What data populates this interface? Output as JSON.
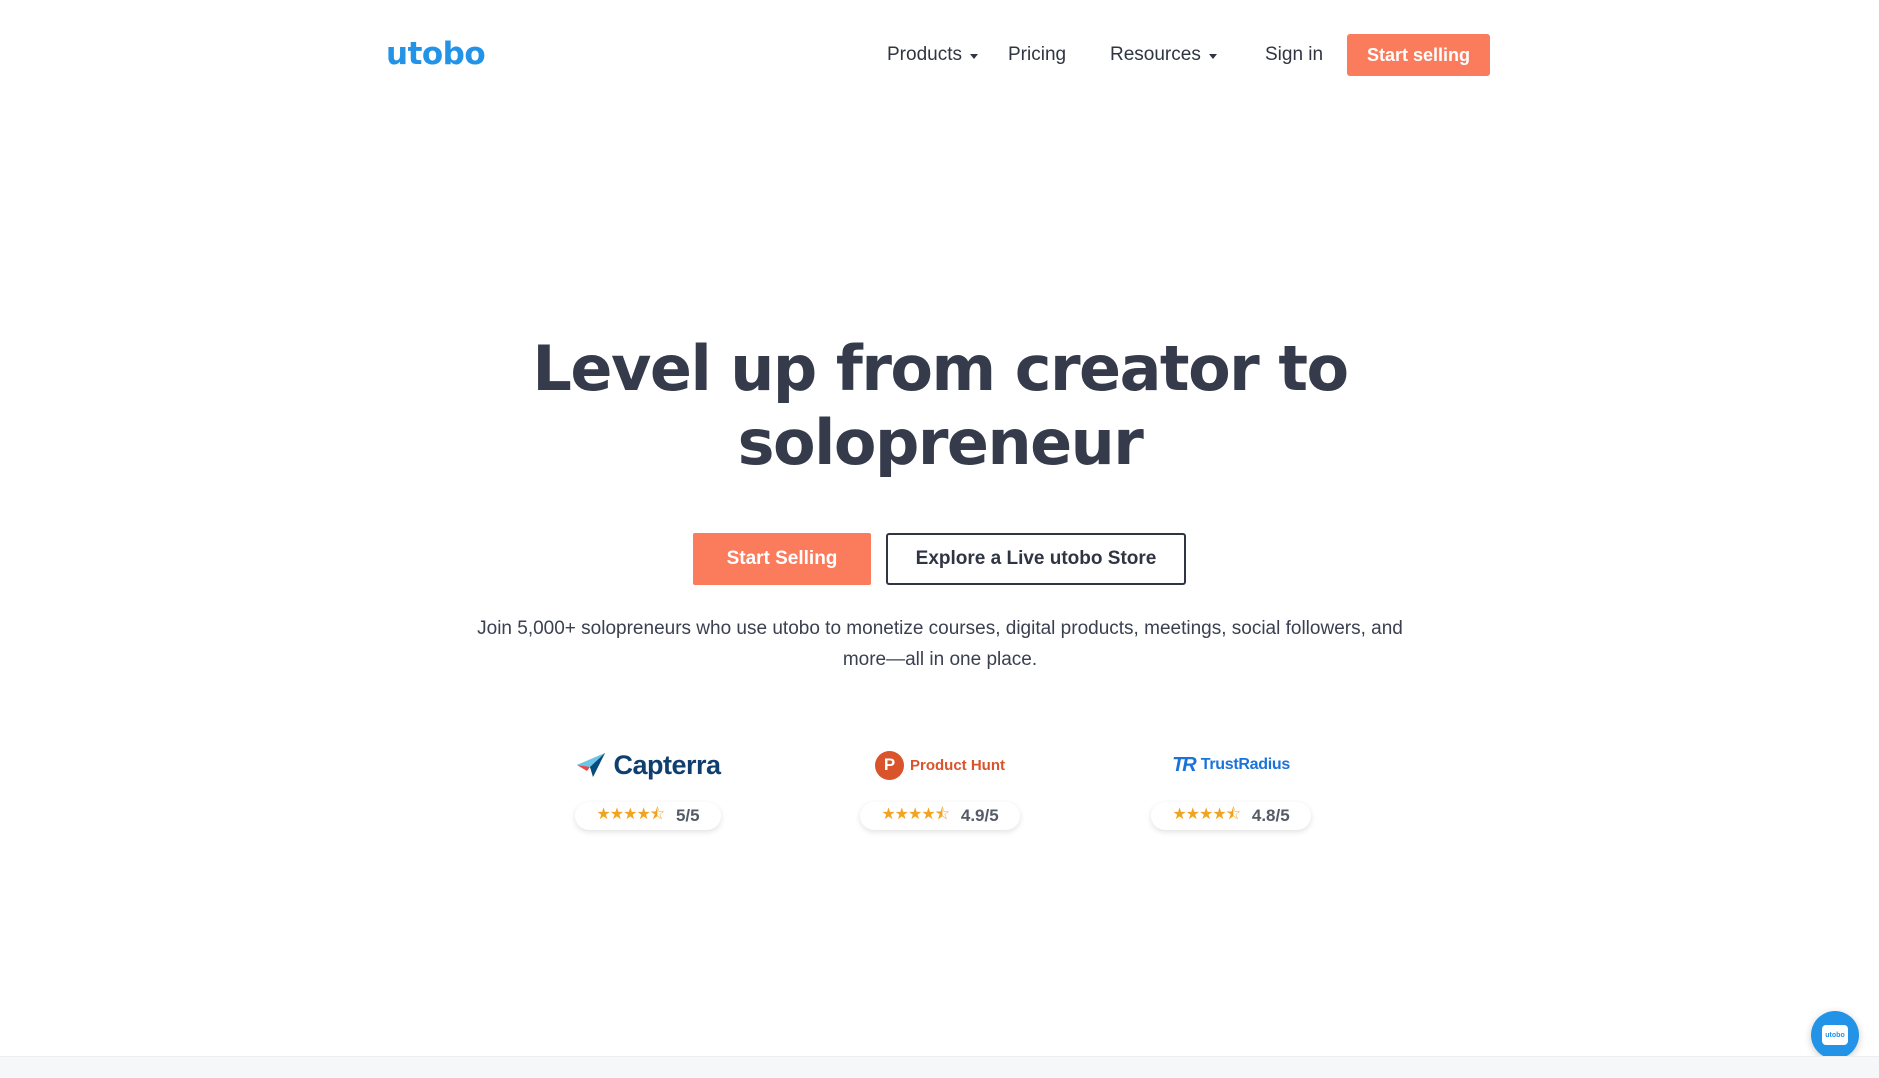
{
  "header": {
    "logo": "utobo",
    "nav": [
      {
        "label": "Products",
        "dropdown": true
      },
      {
        "label": "Pricing",
        "dropdown": false
      },
      {
        "label": "Resources",
        "dropdown": true
      },
      {
        "label": "Sign in",
        "dropdown": false
      }
    ],
    "cta_label": "Start selling"
  },
  "hero": {
    "title_line1": "Level up from creator to",
    "title_line2": "solopreneur",
    "primary_button": "Start Selling",
    "secondary_button": "Explore a Live utobo Store",
    "subtitle_line1": "Join 5,000+ solopreneurs who use utobo to monetize courses, digital products, meetings, social followers, and",
    "subtitle_line2": "more—all in one place."
  },
  "reviews": [
    {
      "brand": "Capterra",
      "stars": 4.5,
      "score": "5/5",
      "icon": "capterra-logo-icon"
    },
    {
      "brand": "Product Hunt",
      "badge": "P",
      "stars": 4.5,
      "score": "4.9/5",
      "icon": "product-hunt-logo-icon"
    },
    {
      "brand": "TrustRadius",
      "mark": "TR",
      "stars": 4.5,
      "score": "4.8/5",
      "icon": "trustradius-logo-icon"
    }
  ],
  "chat_widget": {
    "label": "utobo",
    "icon": "chat-bubble-icon"
  },
  "colors": {
    "brand_blue": "#2293e6",
    "accent_orange": "#fb7c5d",
    "text_dark": "#353b4a",
    "star_gold": "#f2a31f"
  }
}
